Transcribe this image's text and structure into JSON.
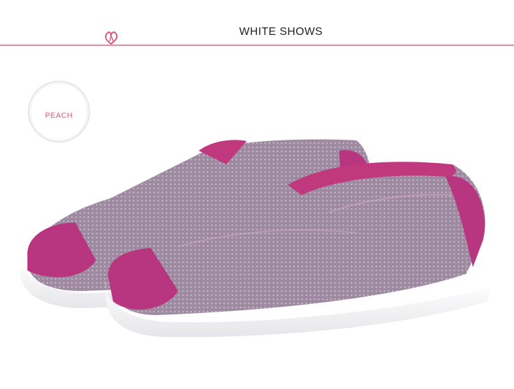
{
  "header": {
    "title": "WHITE SHOWS"
  },
  "badge": {
    "label": "PEACH"
  },
  "colors": {
    "accent_line": "#e88a9a",
    "badge_text": "#e0577c",
    "shoe_trim": "#b8357f",
    "shoe_mesh": "#9b7f99",
    "sole": "#f4f4f6"
  },
  "icons": {
    "header_mark": "ribbon-icon"
  }
}
